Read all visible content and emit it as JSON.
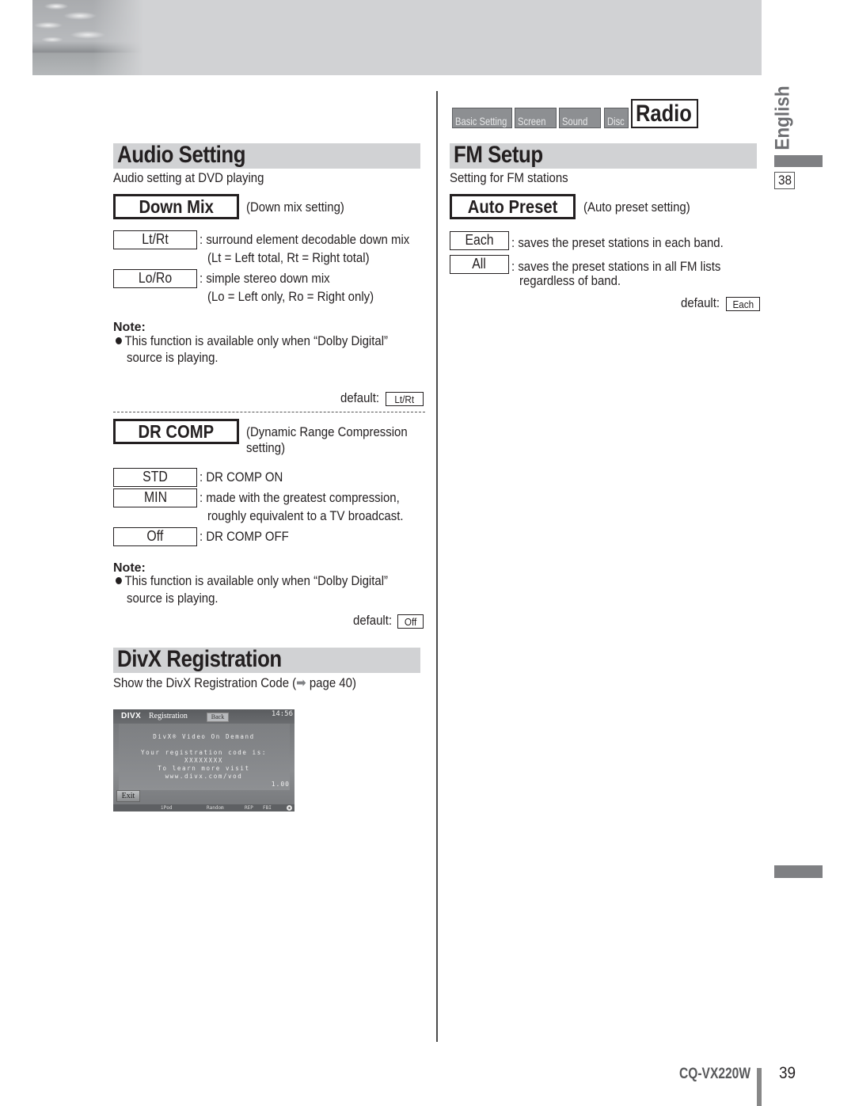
{
  "header": {
    "banner_image": "sky-sea-photo"
  },
  "menu_tabs": {
    "tabs": [
      {
        "label": "Basic Setting"
      },
      {
        "label": "Screen"
      },
      {
        "label": "Sound"
      },
      {
        "label": "Disc"
      }
    ],
    "active": {
      "label": "Radio"
    }
  },
  "audio_setting": {
    "title": "Audio Setting",
    "subtitle": "Audio setting at DVD playing",
    "down_mix": {
      "key": "Down Mix",
      "desc": "(Down mix setting)",
      "options": [
        {
          "key": "Lt/Rt",
          "desc": ": surround element decodable down mix",
          "desc2": "(Lt = Left total, Rt = Right total)"
        },
        {
          "key": "Lo/Ro",
          "desc": ": simple stereo down mix",
          "desc2": "(Lo = Left only, Ro = Right only)"
        }
      ],
      "note_label": "Note:",
      "note_line1": "This function is available only when “Dolby Digital”",
      "note_line2": "source is playing.",
      "default_label": "default:",
      "default_value": "Lt/Rt"
    },
    "dr_comp": {
      "key": "DR COMP",
      "desc": "(Dynamic Range Compression",
      "desc2": "setting)",
      "options": [
        {
          "key": "STD",
          "desc": ": DR COMP ON"
        },
        {
          "key": "MIN",
          "desc": ": made with the greatest compression,",
          "desc2": "roughly equivalent to a TV broadcast."
        },
        {
          "key": "Off",
          "desc": ": DR COMP OFF"
        }
      ],
      "note_label": "Note:",
      "note_line1": "This function is available only when “Dolby Digital”",
      "note_line2": "source is playing.",
      "default_label": "default:",
      "default_value": "Off"
    }
  },
  "divx_registration": {
    "title": "DivX Registration",
    "subtitle_pre": "Show the DivX Registration Code (",
    "subtitle_arrow": "➡",
    "subtitle_post": " page 40)",
    "screen": {
      "logo": "DIVX",
      "title": "Registration",
      "back_label": "Back",
      "time": "14:56",
      "lines": [
        "DivX® Video On Demand",
        "Your registration code is:",
        "XXXXXXXX",
        "To learn more visit",
        "www.divx.com/vod"
      ],
      "version": "1.00",
      "exit_label": "Exit",
      "bottom_items": [
        "iPod",
        "Random",
        "REP",
        "FBI"
      ]
    }
  },
  "fm_setup": {
    "title": "FM Setup",
    "subtitle": "Setting for FM stations",
    "auto_preset": {
      "key": "Auto Preset",
      "desc": "(Auto preset setting)",
      "options": [
        {
          "key": "Each",
          "desc": ": saves the preset stations in each band."
        },
        {
          "key": "All",
          "desc": ": saves the preset stations in all FM lists",
          "desc2": "regardless of band."
        }
      ],
      "default_label": "default:",
      "default_value": "Each"
    }
  },
  "side_rail": {
    "language": "English",
    "page_ref": "38"
  },
  "footer": {
    "model": "CQ-VX220W",
    "page_number": "39"
  }
}
